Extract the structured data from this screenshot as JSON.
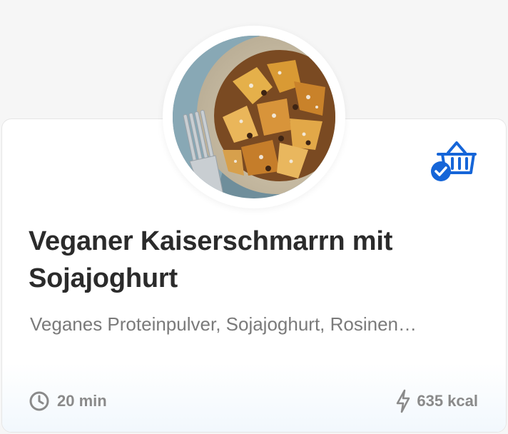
{
  "recipe": {
    "title": "Veganer Kaiserschmarrn mit Sojajoghurt",
    "ingredients": "Veganes Proteinpulver, Sojajoghurt, Rosinen…",
    "time": "20 min",
    "energy": "635 kcal"
  },
  "icons": {
    "basket": "shopping-basket-check-icon",
    "clock": "clock-icon",
    "energy": "lightning-bolt-icon"
  },
  "colors": {
    "accent": "#1565d8",
    "title": "#2b2b2b",
    "muted": "#7a7a7a",
    "meta": "#8a8a8a"
  }
}
